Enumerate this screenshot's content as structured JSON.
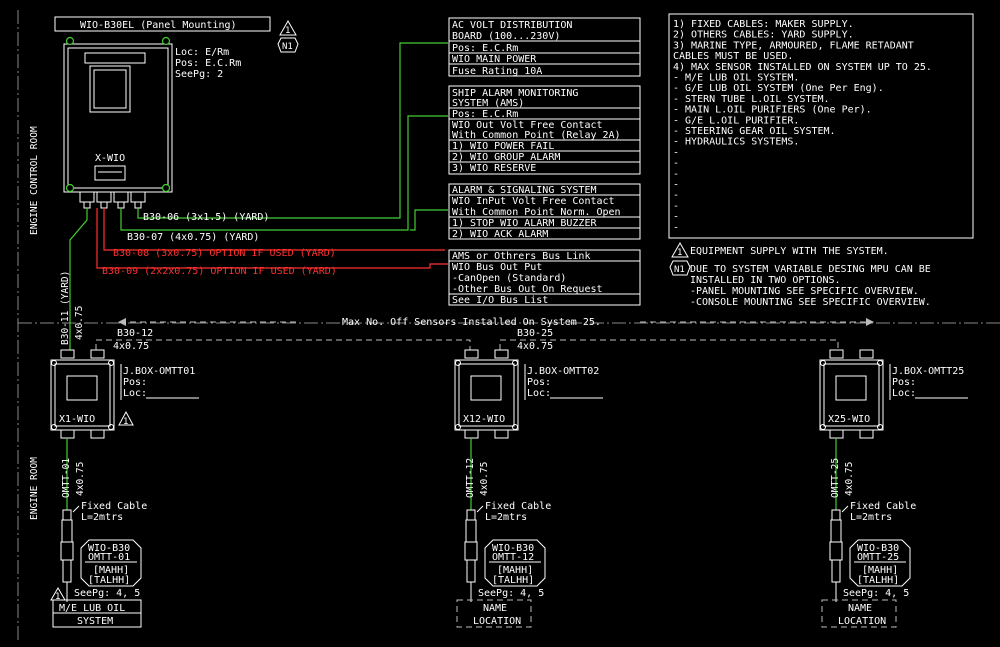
{
  "panel": {
    "title": "WIO-B30EL (Panel Mounting)",
    "loc": "Loc: E/Rm",
    "pos": "Pos: E.C.Rm",
    "seepg": "SeePg: 2",
    "name": "X-WIO"
  },
  "marks": {
    "one": "1",
    "n1": "N1"
  },
  "rooms": {
    "control": "ENGINE CONTROL ROOM",
    "engine": "ENGINE ROOM"
  },
  "ac_box": [
    "AC VOLT DISTRIBUTION",
    "BOARD (100...230V)",
    "Pos: E.C.Rm",
    "WIO MAIN POWER",
    "Fuse Rating 10A"
  ],
  "ams_box": [
    "SHIP ALARM MONITORING",
    "SYSTEM (AMS)",
    "Pos: E.C.Rm",
    "WIO Out Volt Free Contact",
    "With Common Point (Relay 2A)",
    "1) WIO POWER FAIL",
    "2) WIO GROUP ALARM",
    "3) WIO RESERVE"
  ],
  "alarm_box": [
    "ALARM & SIGNALING SYSTEM",
    "WIO InPut Volt Free Contact",
    "With Common Point Norm. Open",
    "1) STOP WIO ALARM BUZZER",
    "2) WIO ACK ALARM"
  ],
  "bus_box": [
    "AMS or Othrers Bus Link",
    "WIO Bus Out Put",
    "-CanOpen (Standard)",
    "-Other Bus Out On Request",
    "See I/O Bus List"
  ],
  "notes": [
    "1) FIXED CABLES: MAKER SUPPLY.",
    "2) OTHERS CABLES: YARD SUPPLY.",
    "3) MARINE TYPE, ARMOURED, FLAME RETADANT",
    "CABLES MUST BE USED.",
    "4) MAX SENSOR INSTALLED ON SYSTEM UP TO 25.",
    "- M/E LUB OIL SYSTEM.",
    "- G/E LUB OIL SYSTEM (One Per Eng).",
    "- STERN TUBE L.OIL SYSTEM.",
    "- MAIN L.OIL PURIFIERS (One Per).",
    "- G/E L.OIL PURIFIER.",
    "- STEERING GEAR OIL SYSTEM.",
    "- HYDRAULICS SYSTEMS.",
    "-",
    "-",
    "-",
    "-",
    "-",
    "-",
    "-",
    "-"
  ],
  "legend": {
    "equip": "EQUIPMENT SUPPLY WITH THE SYSTEM.",
    "n1_lines": [
      "DUE TO SYSTEM VARIABLE DESING MPU CAN BE",
      "INSTALLED IN TWO OPTIONS.",
      "-PANEL MOUNTING SEE SPECIFIC OVERVIEW.",
      "-CONSOLE MOUNTING SEE SPECIFIC OVERVIEW."
    ]
  },
  "cables": {
    "c06": "B30-06 (3x1.5) (YARD)",
    "c07": "B30-07 (4x0.75) (YARD)",
    "c08": "B30-08 (3x0.75) OPTION IF USED (YARD)",
    "c09": "B30-09 (2x2x0.75) OPTION IF USED (YARD)",
    "c11": "B30-11 (YARD)",
    "c11b": "4x0.75",
    "c12": "B30-12",
    "c12b": "4x0.75",
    "c25": "B30-25",
    "c25b": "4x0.75"
  },
  "max_sensors": "Max No. Off Sensors Installed On System 25.",
  "jboxes": [
    {
      "label": "J.BOX-OMTT01",
      "pos": "Pos:",
      "loc": "Loc:",
      "unit": "X1-WIO",
      "cable": "OMTT-01",
      "size": "4x0.75",
      "fixed": "Fixed Cable",
      "len": "L=2mtrs",
      "sensor1": "WIO-B30",
      "sensor2": "OMTT-01",
      "s3": "[MAHH]",
      "s4": "[TALHH]",
      "seepg": "SeePg: 4, 5",
      "sys1": "M/E LUB OIL",
      "sys2": "SYSTEM"
    },
    {
      "label": "J.BOX-OMTT02",
      "pos": "Pos:",
      "loc": "Loc:",
      "unit": "X12-WIO",
      "cable": "OMTT-12",
      "size": "4x0.75",
      "fixed": "Fixed Cable",
      "len": "L=2mtrs",
      "sensor1": "WIO-B30",
      "sensor2": "OMTT-12",
      "s3": "[MAHH]",
      "s4": "[TALHH]",
      "seepg": "SeePg: 4, 5",
      "sys1": "NAME",
      "sys2": "LOCATION"
    },
    {
      "label": "J.BOX-OMTT25",
      "pos": "Pos:",
      "loc": "Loc:",
      "unit": "X25-WIO",
      "cable": "OMTT-25",
      "size": "4x0.75",
      "fixed": "Fixed Cable",
      "len": "L=2mtrs",
      "sensor1": "WIO-B30",
      "sensor2": "OMTT-25",
      "s3": "[MAHH]",
      "s4": "[TALHH]",
      "seepg": "SeePg: 4, 5",
      "sys1": "NAME",
      "sys2": "LOCATION"
    }
  ]
}
